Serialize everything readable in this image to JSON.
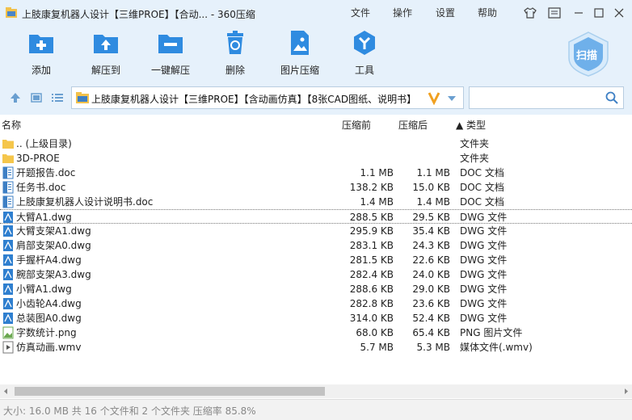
{
  "window": {
    "title": "上肢康复机器人设计【三维PROE】【合动... - 360压缩",
    "menus": [
      "文件",
      "操作",
      "设置",
      "帮助"
    ]
  },
  "toolbar": {
    "items": [
      {
        "label": "添加",
        "icon": "add-icon"
      },
      {
        "label": "解压到",
        "icon": "extract-to-icon"
      },
      {
        "label": "一键解压",
        "icon": "one-click-extract-icon"
      },
      {
        "label": "删除",
        "icon": "delete-icon"
      },
      {
        "label": "图片压缩",
        "icon": "image-compress-icon"
      },
      {
        "label": "工具",
        "icon": "tools-icon"
      }
    ],
    "scan_label": "扫描"
  },
  "address": {
    "path": "上肢康复机器人设计【三维PROE】【含动画仿真】【8张CAD图纸、说明书】",
    "search_placeholder": ""
  },
  "columns": {
    "name": "名称",
    "before": "压缩前",
    "after": "压缩后",
    "type": "▲ 类型"
  },
  "files": [
    {
      "name": ".. (上级目录)",
      "before": "",
      "after": "",
      "type": "文件夹",
      "icon": "folder"
    },
    {
      "name": "3D-PROE",
      "before": "",
      "after": "",
      "type": "文件夹",
      "icon": "folder"
    },
    {
      "name": "开题报告.doc",
      "before": "1.1 MB",
      "after": "1.1 MB",
      "type": "DOC 文档",
      "icon": "doc"
    },
    {
      "name": "任务书.doc",
      "before": "138.2 KB",
      "after": "15.0 KB",
      "type": "DOC 文档",
      "icon": "doc"
    },
    {
      "name": "上肢康复机器人设计说明书.doc",
      "before": "1.4 MB",
      "after": "1.4 MB",
      "type": "DOC 文档",
      "icon": "doc"
    },
    {
      "name": "大臂A1.dwg",
      "before": "288.5 KB",
      "after": "29.5 KB",
      "type": "DWG 文件",
      "icon": "dwg"
    },
    {
      "name": "大臂支架A1.dwg",
      "before": "295.9 KB",
      "after": "35.4 KB",
      "type": "DWG 文件",
      "icon": "dwg"
    },
    {
      "name": "肩部支架A0.dwg",
      "before": "283.1 KB",
      "after": "24.3 KB",
      "type": "DWG 文件",
      "icon": "dwg"
    },
    {
      "name": "手握杆A4.dwg",
      "before": "281.5 KB",
      "after": "22.6 KB",
      "type": "DWG 文件",
      "icon": "dwg"
    },
    {
      "name": "腕部支架A3.dwg",
      "before": "282.4 KB",
      "after": "24.0 KB",
      "type": "DWG 文件",
      "icon": "dwg"
    },
    {
      "name": "小臂A1.dwg",
      "before": "288.6 KB",
      "after": "29.0 KB",
      "type": "DWG 文件",
      "icon": "dwg"
    },
    {
      "name": "小齿轮A4.dwg",
      "before": "282.8 KB",
      "after": "23.6 KB",
      "type": "DWG 文件",
      "icon": "dwg"
    },
    {
      "name": "总装图A0.dwg",
      "before": "314.0 KB",
      "after": "52.4 KB",
      "type": "DWG 文件",
      "icon": "dwg"
    },
    {
      "name": "字数统计.png",
      "before": "68.0 KB",
      "after": "65.4 KB",
      "type": "PNG 图片文件",
      "icon": "png"
    },
    {
      "name": "仿真动画.wmv",
      "before": "5.7 MB",
      "after": "5.3 MB",
      "type": "媒体文件(.wmv)",
      "icon": "wmv"
    }
  ],
  "focused_row": 5,
  "status": {
    "text": "大小: 16.0 MB 共 16 个文件和 2 个文件夹 压缩率 85.8%"
  },
  "colors": {
    "accent": "#2f8be0",
    "toolbar_bg": "#e6f1fb",
    "folder": "#f5c64b"
  }
}
